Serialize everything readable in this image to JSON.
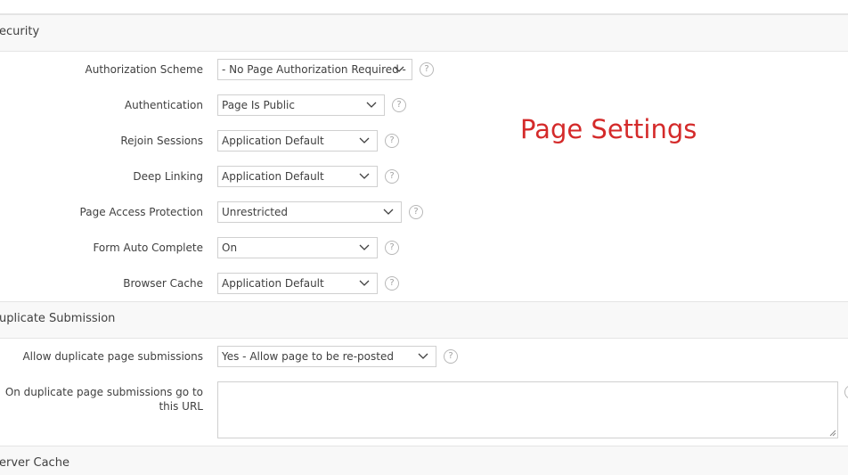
{
  "overlay_title": "Page Settings",
  "sections": {
    "security": "ecurity",
    "duplicate": "uplicate Submission",
    "server_cache": "erver Cache"
  },
  "fields": {
    "authorization_scheme": {
      "label": "Authorization Scheme",
      "value": "- No Page Authorization Required -"
    },
    "authentication": {
      "label": "Authentication",
      "value": "Page Is Public"
    },
    "rejoin_sessions": {
      "label": "Rejoin Sessions",
      "value": "Application Default"
    },
    "deep_linking": {
      "label": "Deep Linking",
      "value": "Application Default"
    },
    "page_access_protection": {
      "label": "Page Access Protection",
      "value": "Unrestricted"
    },
    "form_auto_complete": {
      "label": "Form Auto Complete",
      "value": "On"
    },
    "browser_cache": {
      "label": "Browser Cache",
      "value": "Application Default"
    },
    "allow_duplicate": {
      "label": "Allow duplicate page submissions",
      "value": "Yes - Allow page to be re-posted"
    },
    "duplicate_url": {
      "label": "On duplicate page submissions go to this URL",
      "value": ""
    }
  },
  "help_glyph": "?",
  "colors": {
    "overlay_title": "#d42a2a",
    "section_bg": "#f8f8f8",
    "border": "#d0d0d0"
  }
}
